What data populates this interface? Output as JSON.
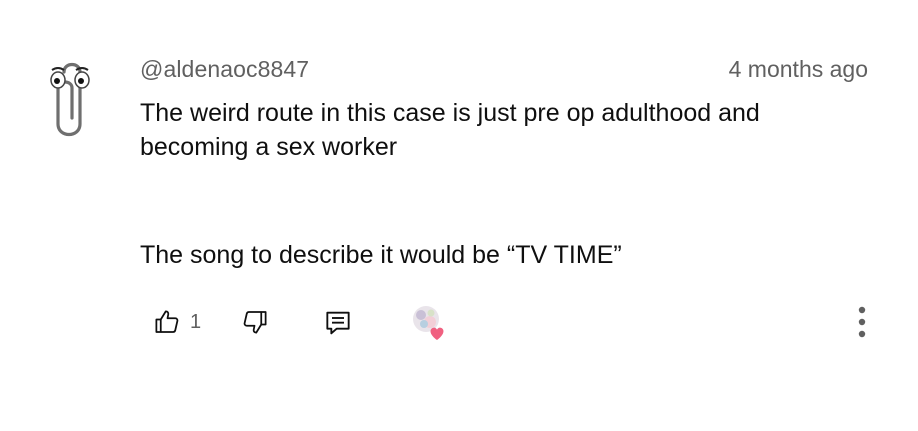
{
  "comment": {
    "author": "@aldenaoc8847",
    "timestamp": "4 months ago",
    "paragraphs": [
      "The weird route in this case is just pre op adulthood and becoming a sex worker",
      "The song to describe it would be “TV TIME”"
    ],
    "likes": "1",
    "avatar_icon": "paperclip-assistant-icon"
  },
  "actions": {
    "like_icon": "thumbs-up-icon",
    "dislike_icon": "thumbs-down-icon",
    "reply_icon": "reply-comment-icon",
    "creator_heart_icon": "creator-heart-icon",
    "more_icon": "more-vertical-icon"
  },
  "colors": {
    "text_primary": "#0f0f0f",
    "text_secondary": "#606060",
    "heart": "#f06080"
  }
}
